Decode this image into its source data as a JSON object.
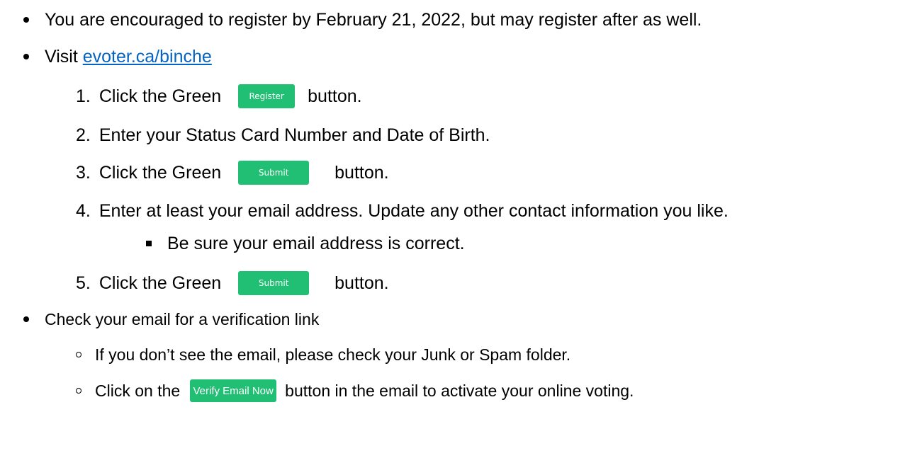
{
  "lines": {
    "l1": "You are encouraged to register by February 21, 2022, but may register after as well.",
    "l2_prefix": "Visit ",
    "l2_link": "evoter.ca/binche",
    "s1_num": "1.",
    "s1_before": "Click the Green",
    "s1_after": "button.",
    "s2_num": "2.",
    "s2_text": "Enter your Status Card Number and Date of Birth.",
    "s3_num": "3.",
    "s3_before": "Click the Green",
    "s3_after": "button.",
    "s4_num": "4.",
    "s4_text": "Enter at least your email address. Update any other contact information you like.",
    "s4_sub": "Be sure your email address is correct.",
    "s5_num": "5.",
    "s5_before": "Click the Green",
    "s5_after": "button.",
    "l3": "Check your email for a verification link",
    "o1": "If you don’t see the email, please check your Junk or Spam folder.",
    "o2_before": "Click on the",
    "o2_after": "button in the email to activate your online voting."
  },
  "buttons": {
    "register": "Register",
    "submit_1": "Submit",
    "submit_2": "Submit",
    "verify": "Verify Email Now"
  },
  "colors": {
    "button_green": "#21bf73",
    "link_blue": "#0563c1"
  }
}
